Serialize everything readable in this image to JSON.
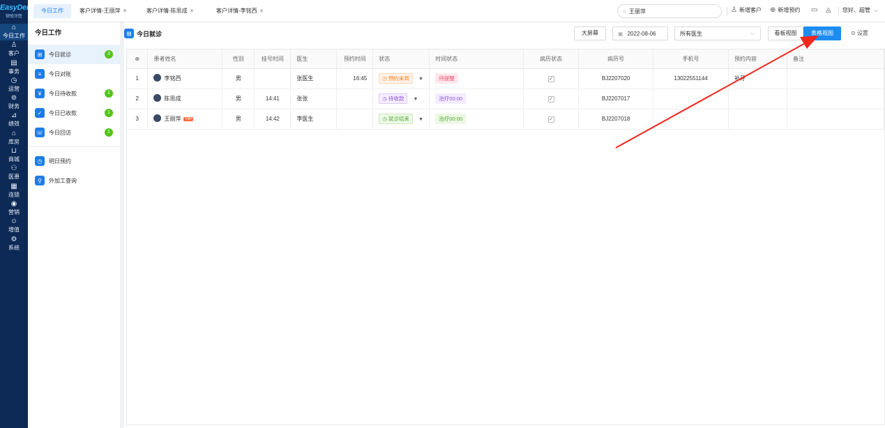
{
  "app": {
    "logo_main": "EasyDent",
    "logo_sub": "顿锐牙医"
  },
  "nav": [
    {
      "icon": "⌂",
      "label": "今日工作",
      "name": "nav-item-today-work",
      "icon_name": "home-icon"
    },
    {
      "icon": "♙",
      "label": "客户",
      "name": "nav-item-customers",
      "icon_name": "user-icon"
    },
    {
      "icon": "▤",
      "label": "事务",
      "name": "nav-item-affairs",
      "icon_name": "document-icon"
    },
    {
      "icon": "◷",
      "label": "运营",
      "name": "nav-item-operations",
      "icon_name": "clock-icon"
    },
    {
      "icon": "⊚",
      "label": "财务",
      "name": "nav-item-finance",
      "icon_name": "money-icon"
    },
    {
      "icon": "⊿",
      "label": "绩效",
      "name": "nav-item-performance",
      "icon_name": "chart-icon"
    },
    {
      "icon": "⌂",
      "label": "库房",
      "name": "nav-item-warehouse",
      "icon_name": "warehouse-icon"
    },
    {
      "icon": "⊔",
      "label": "商城",
      "name": "nav-item-mall",
      "icon_name": "cart-icon"
    },
    {
      "icon": "⚇",
      "label": "医患",
      "name": "nav-item-doctor-patient",
      "icon_name": "people-icon"
    },
    {
      "icon": "▦",
      "label": "连锁",
      "name": "nav-item-chain",
      "icon_name": "building-icon"
    },
    {
      "icon": "◉",
      "label": "营销",
      "name": "nav-item-marketing",
      "icon_name": "target-icon"
    },
    {
      "icon": "☺",
      "label": "增值",
      "name": "nav-item-value-added",
      "icon_name": "gift-icon"
    },
    {
      "icon": "⚙",
      "label": "系统",
      "name": "nav-item-system",
      "icon_name": "gear-icon"
    }
  ],
  "tabs": [
    {
      "label": "今日工作",
      "active": true
    },
    {
      "label": "客户详情-王丽萍",
      "close": "×"
    },
    {
      "label": "客户详情-陈思成",
      "close": "×"
    },
    {
      "label": "客户详情-李铭西",
      "close": "×"
    }
  ],
  "top": {
    "search_value": "王丽萍",
    "new_customer": "新增客户",
    "new_appointment": "新增预约",
    "greeting": "您好、超管"
  },
  "sub": {
    "title": "今日工作",
    "items": [
      {
        "label": "今日就诊",
        "badge": "3",
        "icon": "⊞",
        "name": "sub-item-today-visit",
        "icon_name": "visit-icon",
        "active": true
      },
      {
        "label": "今日对账",
        "badge": "",
        "icon": "≡",
        "name": "sub-item-today-reconcile",
        "icon_name": "list-icon"
      },
      {
        "label": "今日待收款",
        "badge": "1",
        "icon": "¥",
        "name": "sub-item-pending-payment",
        "icon_name": "payment-icon"
      },
      {
        "label": "今日已收款",
        "badge": "1",
        "icon": "✓",
        "name": "sub-item-received-payment",
        "icon_name": "received-icon"
      },
      {
        "label": "今日回访",
        "badge": "1",
        "icon": "☏",
        "name": "sub-item-today-followup",
        "icon_name": "phone-icon"
      }
    ],
    "items2": [
      {
        "label": "明日预约",
        "icon": "◷",
        "name": "sub-item-tomorrow-appointment",
        "icon_name": "calendar-icon"
      },
      {
        "label": "外加工查询",
        "icon": "⚲",
        "name": "sub-item-outsource-query",
        "icon_name": "search-icon"
      }
    ]
  },
  "main": {
    "title": "今日就诊",
    "big_screen": "大屏幕",
    "date": "2022-08-06",
    "doctor_select": "所有医生",
    "board_view": "看板视图",
    "table_view": "表格视图",
    "settings": "设置"
  },
  "table": {
    "headers": [
      "",
      "患者姓名",
      "性别",
      "挂号时间",
      "医生",
      "预约时间",
      "状态",
      "时间状态",
      "病历状态",
      "病历号",
      "手机号",
      "预约内容",
      "备注"
    ],
    "rows": [
      {
        "no": "1",
        "name": "李铭西",
        "vip": "",
        "gender": "男",
        "reg_time": "",
        "doctor": "张医生",
        "appt_time": "16:45",
        "status": "预约未到",
        "status_style": "orange",
        "time_status": "待提醒",
        "time_style": "pink",
        "record_checked": "✓",
        "record_no": "BJ2207020",
        "phone": "13022551144",
        "appt_content": "补牙",
        "note": ""
      },
      {
        "no": "2",
        "name": "陈思成",
        "vip": "",
        "gender": "男",
        "reg_time": "14:41",
        "doctor": "张张",
        "appt_time": "",
        "status": "待收款",
        "status_style": "purple",
        "time_status": "治疗00:00",
        "time_style": "purple",
        "record_checked": "✓",
        "record_no": "BJ2207017",
        "phone": "",
        "appt_content": "",
        "note": ""
      },
      {
        "no": "3",
        "name": "王丽萍",
        "vip": "VIP",
        "gender": "男",
        "reg_time": "14:42",
        "doctor": "李医生",
        "appt_time": "",
        "status": "就诊结束",
        "status_style": "green",
        "time_status": "治疗00:00",
        "time_style": "green",
        "record_checked": "✓",
        "record_no": "BJ2207018",
        "phone": "",
        "appt_content": "",
        "note": ""
      }
    ]
  },
  "colors": {
    "nav_bg": "#0c2a55",
    "accent": "#1d8cf0",
    "badge_green": "#52c41a",
    "arrow_red": "#f0281e"
  }
}
